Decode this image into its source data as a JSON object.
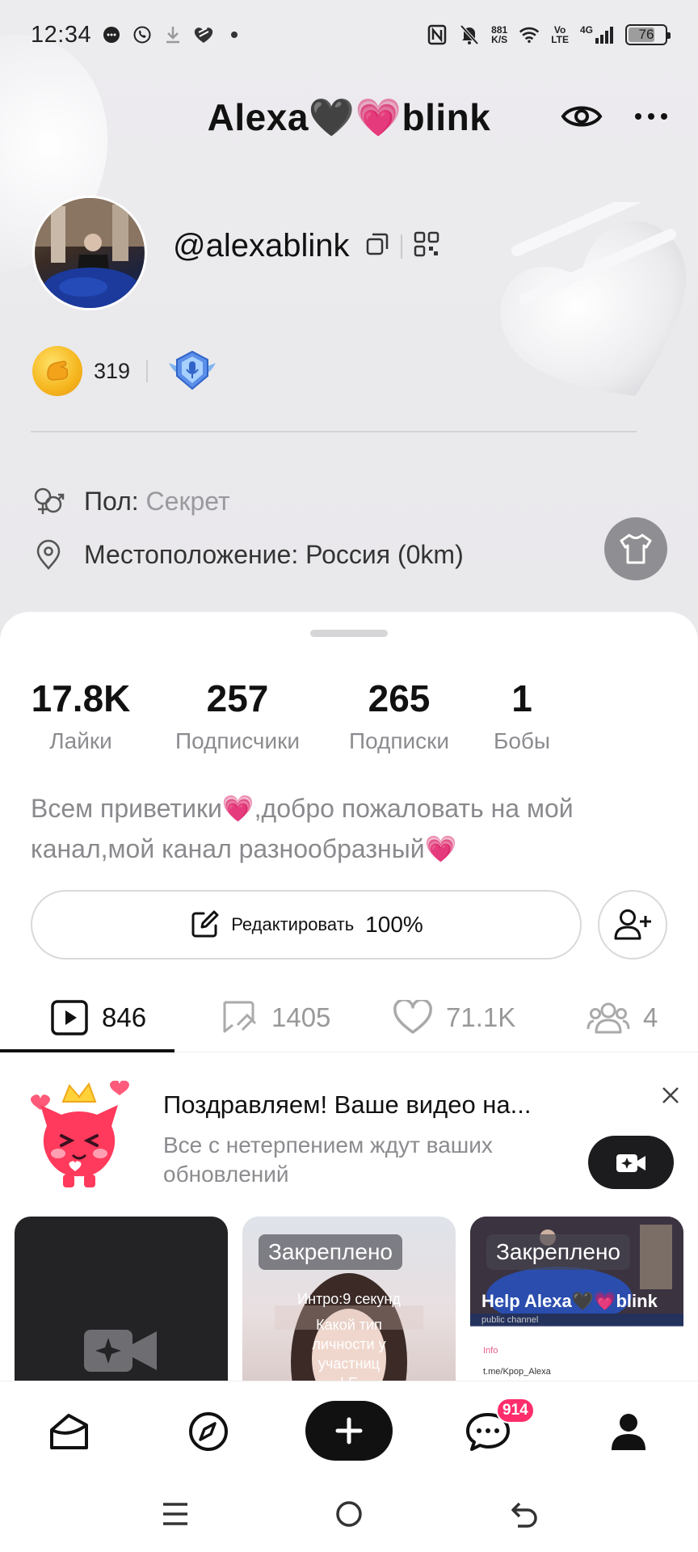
{
  "status_bar": {
    "time": "12:34",
    "net_speed_value": "881",
    "net_speed_unit": "K/S",
    "volte_top": "Vo",
    "volte_bottom": "LTE",
    "signal": "4G",
    "battery": "76",
    "battery_level_pct": 76
  },
  "profile": {
    "display_name": "Alexa🖤💗blink",
    "handle": "@alexablink",
    "coins": "319",
    "gender_label": "Пол:",
    "gender_value": "Секрет",
    "location": "Местоположение: Россия (0km)"
  },
  "stats": [
    {
      "value": "17.8K",
      "label": "Лайки"
    },
    {
      "value": "257",
      "label": "Подписчики"
    },
    {
      "value": "265",
      "label": "Подписки"
    },
    {
      "value": "1",
      "label": "Бобы"
    }
  ],
  "bio_line1": "Всем приветики💗,добро пожаловать на мой",
  "bio_line2": "канал,мой канал разнообразный💗",
  "edit": {
    "label": "Редактировать",
    "percent": "100%"
  },
  "tabs": [
    {
      "icon": "video-icon",
      "value": "846"
    },
    {
      "icon": "repost-icon",
      "value": "1405"
    },
    {
      "icon": "heart-icon",
      "value": "71.1K"
    },
    {
      "icon": "group-icon",
      "value": "4"
    }
  ],
  "notification": {
    "title": "Поздравляем! Ваше видео на...",
    "subtitle": "Все с нетерпением ждут ваших обновлений"
  },
  "videos": [
    {
      "pinned": ""
    },
    {
      "pinned": "Закреплено",
      "intro": "Интро:9 секунд",
      "caption": "Какой тип личности у участниц LE"
    },
    {
      "pinned": "Закреплено",
      "title": "Help Alexa🖤💗blink",
      "sub": "public channel",
      "info": "Info",
      "link": "t.me/Kpop_Alexa"
    }
  ],
  "bottom_nav": {
    "messages_badge": "914"
  },
  "colors": {
    "accent_pink": "#ff2d6b",
    "sheet_bg": "#ffffff",
    "top_bg": "#ecebee"
  }
}
